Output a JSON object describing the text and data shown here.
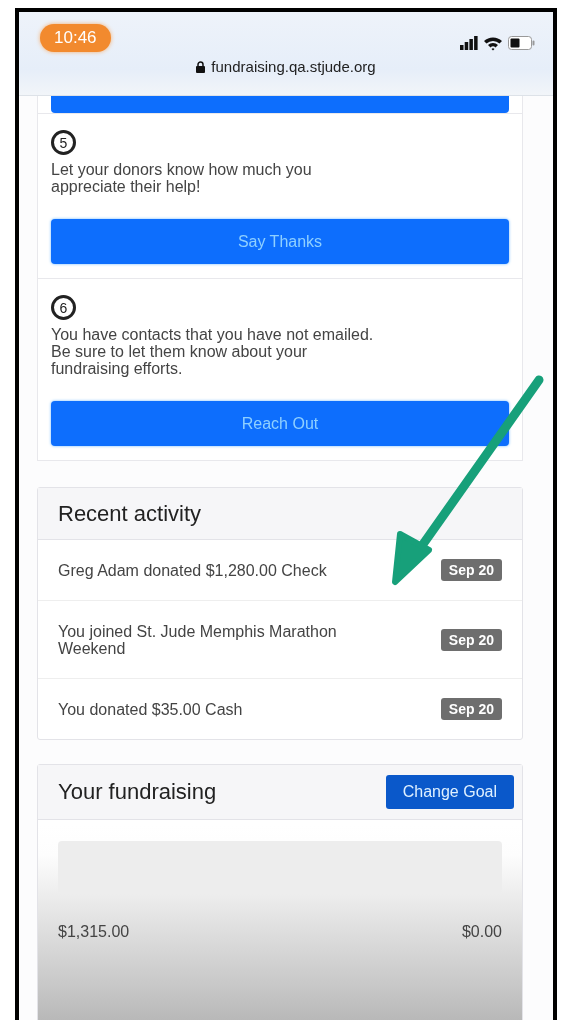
{
  "status_bar": {
    "time": "10:46",
    "url": "fundraising.qa.stjude.org"
  },
  "steps": [
    {
      "number": "5",
      "text": "Let your donors know how much you\nappreciate their help!",
      "button": "Say Thanks"
    },
    {
      "number": "6",
      "text": "You have contacts that you have not emailed.\nBe sure to let them know about your\nfundraising efforts.",
      "button": "Reach Out"
    }
  ],
  "recent_activity": {
    "title": "Recent activity",
    "items": [
      {
        "text": "Greg Adam donated $1,280.00 Check",
        "date": "Sep 20"
      },
      {
        "text": "You joined St. Jude Memphis Marathon Weekend",
        "date": "Sep 20"
      },
      {
        "text": "You donated $35.00 Cash",
        "date": "Sep 20"
      }
    ]
  },
  "fundraising": {
    "title": "Your fundraising",
    "button": "Change Goal",
    "progress": {
      "level": 0
    },
    "raised": "$1,315.00",
    "goal": "$0.00"
  }
}
